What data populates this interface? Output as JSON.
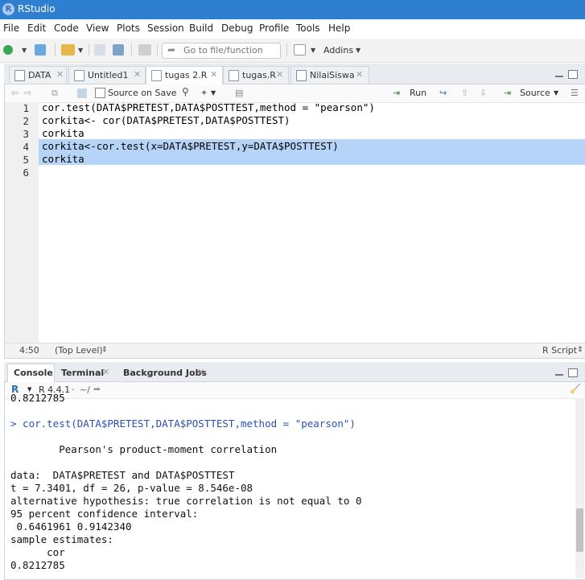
{
  "window": {
    "title": "RStudio",
    "logo_letter": "R"
  },
  "menu": [
    "File",
    "Edit",
    "Code",
    "View",
    "Plots",
    "Session",
    "Build",
    "Debug",
    "Profile",
    "Tools",
    "Help"
  ],
  "toolbar": {
    "goto_placeholder": "Go to file/function",
    "addins_label": "Addins"
  },
  "source_tabs": [
    {
      "label": "DATA",
      "active": false
    },
    {
      "label": "Untitled1",
      "active": false
    },
    {
      "label": "tugas 2.R",
      "active": true
    },
    {
      "label": "tugas.R",
      "active": false
    },
    {
      "label": "NilaiSiswa",
      "active": false
    }
  ],
  "editor_toolbar": {
    "source_on_save": "Source on Save",
    "run": "Run",
    "source": "Source"
  },
  "editor": {
    "lines": [
      {
        "num": "1",
        "code": "cor.test(DATA$PRETEST,DATA$POSTTEST,method = \"pearson\")"
      },
      {
        "num": "2",
        "code": "corkita<- cor(DATA$PRETEST,DATA$POSTTEST)"
      },
      {
        "num": "3",
        "code": "corkita"
      },
      {
        "num": "4",
        "code": "corkita<-cor.test(x=DATA$PRETEST,y=DATA$POSTTEST)"
      },
      {
        "num": "5",
        "code": "corkita"
      },
      {
        "num": "6",
        "code": ""
      }
    ]
  },
  "status": {
    "position": "4:50",
    "scope": "(Top Level)",
    "file_type": "R Script"
  },
  "console_tabs": [
    {
      "label": "Console",
      "active": true
    },
    {
      "label": "Terminal",
      "active": false
    },
    {
      "label": "Background Jobs",
      "active": false
    }
  ],
  "console_bar": {
    "r_version": "R 4.4.1",
    "path": "~/"
  },
  "console": {
    "lines": [
      {
        "text": "0.8212785",
        "kind": "output"
      },
      {
        "text": "",
        "kind": "output"
      },
      {
        "text": "> cor.test(DATA$PRETEST,DATA$POSTTEST,method = \"pearson\")",
        "kind": "command"
      },
      {
        "text": "",
        "kind": "output"
      },
      {
        "text": "        Pearson's product-moment correlation",
        "kind": "output"
      },
      {
        "text": "",
        "kind": "output"
      },
      {
        "text": "data:  DATA$PRETEST and DATA$POSTTEST",
        "kind": "output"
      },
      {
        "text": "t = 7.3401, df = 26, p-value = 8.546e-08",
        "kind": "output"
      },
      {
        "text": "alternative hypothesis: true correlation is not equal to 0",
        "kind": "output"
      },
      {
        "text": "95 percent confidence interval:",
        "kind": "output"
      },
      {
        "text": " 0.6461961 0.9142340",
        "kind": "output"
      },
      {
        "text": "sample estimates:",
        "kind": "output"
      },
      {
        "text": "      cor",
        "kind": "output"
      },
      {
        "text": "0.8212785",
        "kind": "output"
      }
    ]
  }
}
